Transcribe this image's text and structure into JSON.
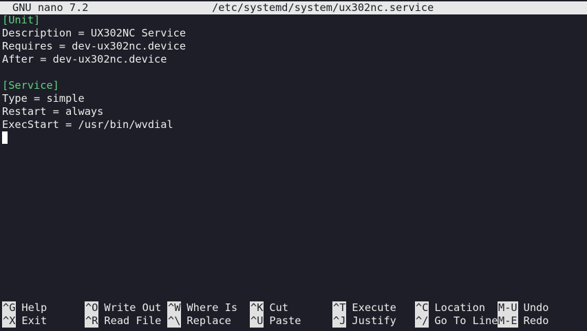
{
  "titlebar": {
    "version": "GNU nano 7.2",
    "filename": "/etc/systemd/system/ux302nc.service"
  },
  "editor": {
    "lines": [
      {
        "text": "[Unit]",
        "kind": "section"
      },
      {
        "text": "Description = UX302NC Service",
        "kind": "text"
      },
      {
        "text": "Requires = dev-ux302nc.device",
        "kind": "text"
      },
      {
        "text": "After = dev-ux302nc.device",
        "kind": "text"
      },
      {
        "text": "",
        "kind": "text"
      },
      {
        "text": "[Service]",
        "kind": "section"
      },
      {
        "text": "Type = simple",
        "kind": "text"
      },
      {
        "text": "Restart = always",
        "kind": "text"
      },
      {
        "text": "ExecStart = /usr/bin/wvdial",
        "kind": "text"
      }
    ]
  },
  "shortcuts": {
    "row1": [
      {
        "key": "^G",
        "label": "Help"
      },
      {
        "key": "^O",
        "label": "Write Out"
      },
      {
        "key": "^W",
        "label": "Where Is"
      },
      {
        "key": "^K",
        "label": "Cut"
      },
      {
        "key": "^T",
        "label": "Execute"
      },
      {
        "key": "^C",
        "label": "Location"
      },
      {
        "key": "M-U",
        "label": "Undo"
      }
    ],
    "row2": [
      {
        "key": "^X",
        "label": "Exit"
      },
      {
        "key": "^R",
        "label": "Read File"
      },
      {
        "key": "^\\",
        "label": "Replace"
      },
      {
        "key": "^U",
        "label": "Paste"
      },
      {
        "key": "^J",
        "label": "Justify"
      },
      {
        "key": "^/",
        "label": "Go To Line"
      },
      {
        "key": "M-E",
        "label": "Redo"
      }
    ]
  },
  "colors": {
    "background": "#1d1e27",
    "section": "#5fd380",
    "titlebar": "#e8e8e8"
  }
}
